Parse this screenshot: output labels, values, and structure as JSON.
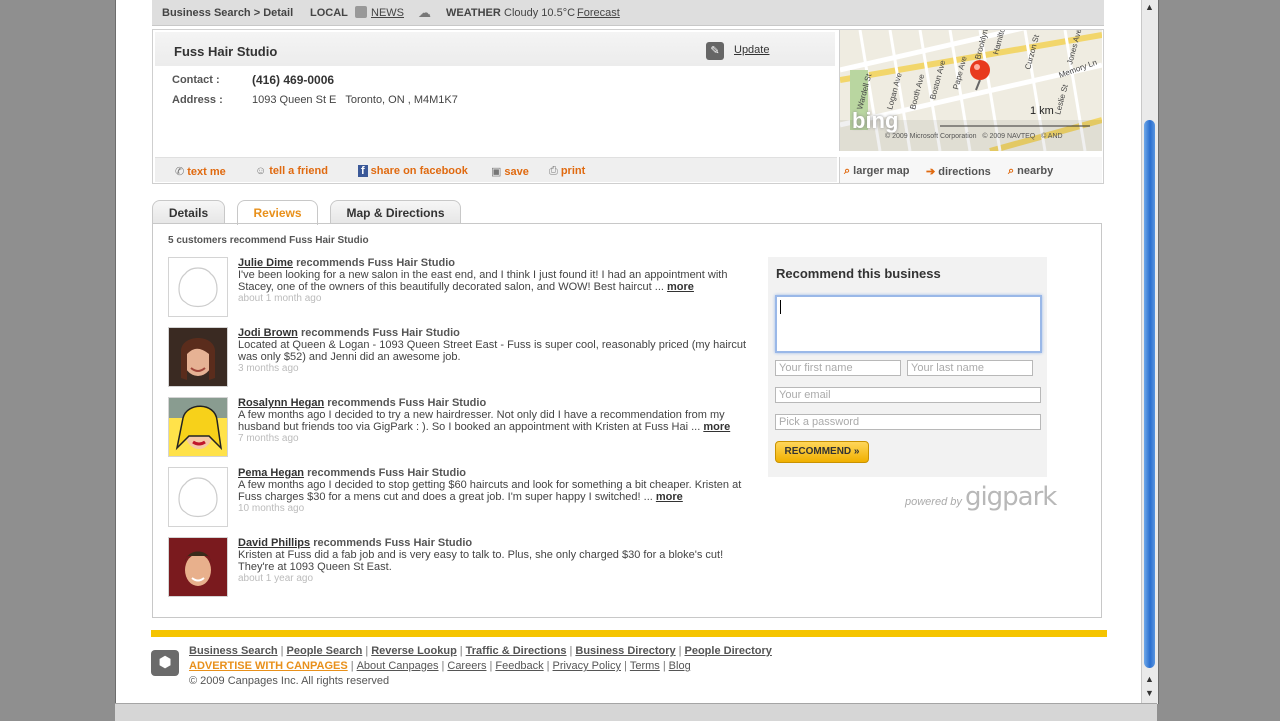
{
  "topbar": {
    "breadcrumb": "Business Search > Detail",
    "local_label": "LOCAL",
    "news_label": "NEWS",
    "weather_label": "WEATHER",
    "weather_text": "Cloudy 10.5°C",
    "forecast_label": "Forecast"
  },
  "business": {
    "name": "Fuss Hair Studio",
    "update_label": "Update",
    "contact_label": "Contact :",
    "phone": "(416) 469-0006",
    "address_label": "Address :",
    "address": "1093 Queen St E   Toronto, ON , M4M1K7"
  },
  "actions": [
    {
      "label": "text me",
      "icon": "phone-icon"
    },
    {
      "label": "tell a friend",
      "icon": "people-icon"
    },
    {
      "label": "share on facebook",
      "icon": "facebook-icon"
    },
    {
      "label": "save",
      "icon": "save-icon"
    },
    {
      "label": "print",
      "icon": "printer-icon"
    }
  ],
  "map": {
    "streets": [
      "Wardell St",
      "Logan Ave",
      "Booth Ave",
      "Boston Ave",
      "Pape Ave",
      "Brooklyn Ave",
      "Hamilton St",
      "Curzon St",
      "Jones Ave",
      "Memory Ln",
      "Leslie St"
    ],
    "scale_label": "1 km",
    "brand": "bing",
    "copyright": "© 2009 Microsoft Corporation   © 2009 NAVTEQ   © AND",
    "links": [
      {
        "label": "larger map",
        "icon": "magnifier-icon"
      },
      {
        "label": "directions",
        "icon": "arrow-icon"
      },
      {
        "label": "nearby",
        "icon": "magnifier-icon"
      }
    ]
  },
  "tabs": [
    "Details",
    "Reviews",
    "Map & Directions"
  ],
  "active_tab": "Reviews",
  "reviews_count_text": "5 customers recommend Fuss Hair Studio",
  "reviews": [
    {
      "name": "Julie Dime",
      "action": " recommends Fuss Hair Studio",
      "text": "I've been looking for a new salon in the east end, and I think I just found it! I had an appointment with Stacey, one of the owners of this beautifully decorated salon, and WOW! Best haircut ...",
      "more": "more",
      "time": "about 1 month ago",
      "avatar": "placeholder"
    },
    {
      "name": "Jodi Brown",
      "action": " recommends Fuss Hair Studio",
      "text": "Located at Queen & Logan - 1093 Queen Street East - Fuss is super cool, reasonably priced (my haircut was only $52) and Jenni did an awesome job.",
      "more": "",
      "time": "3 months ago",
      "avatar": "photo-woman"
    },
    {
      "name": "Rosalynn Hegan",
      "action": " recommends Fuss Hair Studio",
      "text": "A few months ago I decided to try a new hairdresser. Not only did I have a recommendation from my husband but friends too via GigPark : ). So I booked an appointment with Kristen at Fuss Hai ...",
      "more": "more",
      "time": "7 months ago",
      "avatar": "popart"
    },
    {
      "name": "Pema Hegan",
      "action": " recommends Fuss Hair Studio",
      "text": "A few months ago I decided to stop getting $60 haircuts and look for something a bit cheaper. Kristen at Fuss charges $30 for a mens cut and does a great job. I'm super happy I switched! ...",
      "more": "more",
      "time": "10 months ago",
      "avatar": "placeholder"
    },
    {
      "name": "David Phillips",
      "action": " recommends Fuss Hair Studio",
      "text": "Kristen at Fuss did a fab job and is very easy to talk to. Plus, she only charged $30 for a bloke's cut! They're at 1093 Queen St East.",
      "more": "",
      "time": "about 1 year ago",
      "avatar": "photo-man"
    }
  ],
  "recommend": {
    "title": "Recommend this business",
    "first_name_placeholder": "Your first name",
    "last_name_placeholder": "Your last name",
    "email_placeholder": "Your email",
    "password_placeholder": "Pick a password",
    "button_label": "RECOMMEND »",
    "powered_by": "powered by",
    "powered_brand": "gigpark"
  },
  "footer": {
    "links_row1": [
      "Business Search",
      "People Search",
      "Reverse Lookup",
      "Traffic & Directions",
      "Business Directory",
      "People Directory"
    ],
    "advertise_label": "ADVERTISE WITH CANPAGES",
    "links_row2": [
      "About Canpages",
      "Careers",
      "Feedback",
      "Privacy Policy",
      "Terms",
      "Blog"
    ],
    "copyright": "© 2009 Canpages Inc. All rights reserved"
  },
  "colors": {
    "accent_orange": "#e06a10",
    "tab_active": "#e8901b",
    "footer_bar": "#f5c400",
    "scroll_blue": "#2a6fd0"
  }
}
